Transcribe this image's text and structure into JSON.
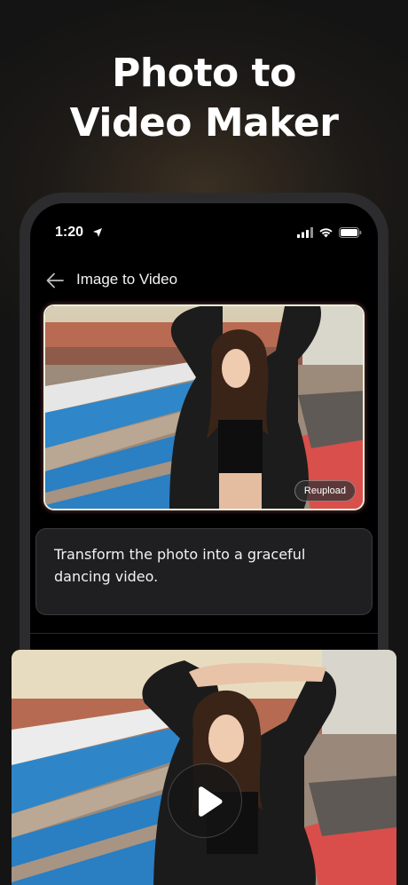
{
  "headline": {
    "line1": "Photo to",
    "line2": "Video Maker"
  },
  "status_bar": {
    "time": "1:20"
  },
  "nav": {
    "title": "Image to Video"
  },
  "source_image": {
    "reupload_label": "Reupload"
  },
  "prompt": {
    "text": "Transform the photo into a graceful dancing video."
  },
  "icons": {
    "back": "back-arrow-icon",
    "location": "location-arrow-icon",
    "signal": "cellular-signal-icon",
    "wifi": "wifi-icon",
    "battery": "battery-icon",
    "play": "play-icon"
  },
  "colors": {
    "accent_border": "#e9f0da",
    "background": "#141414",
    "card": "#1f1f21"
  }
}
